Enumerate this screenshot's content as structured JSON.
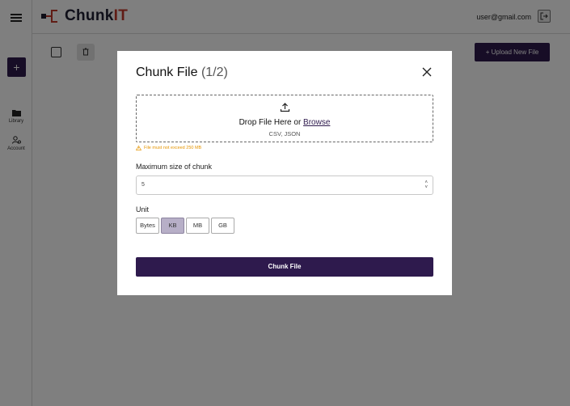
{
  "app": {
    "logo_prefix": "Chunk",
    "logo_accent": "IT",
    "user_email": "user@gmail.com",
    "brand_color": "#2e1a4d",
    "accent_color": "#c0392b"
  },
  "sidebar": {
    "new_label": "+",
    "items": [
      {
        "label": "Library",
        "icon": "folder-icon"
      },
      {
        "label": "Account",
        "icon": "user-settings-icon"
      }
    ]
  },
  "toolbar": {
    "upload_label": "+ Upload New File"
  },
  "modal": {
    "title": "Chunk File",
    "step": "(1/2)",
    "dropzone": {
      "prefix": "Drop File Here or ",
      "browse": "Browse",
      "formats": "CSV, JSON"
    },
    "warning": "File must not exceed 250 MB",
    "warning_color": "#e69500",
    "size_label": "Maximum size of chunk",
    "size_value": "5",
    "unit_label": "Unit",
    "units": [
      "Bytes",
      "KB",
      "MB",
      "GB"
    ],
    "selected_unit": "KB",
    "submit_label": "Chunk File"
  }
}
